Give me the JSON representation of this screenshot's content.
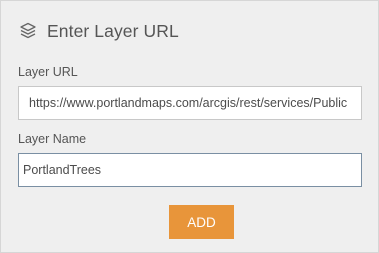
{
  "dialog": {
    "title": "Enter Layer URL",
    "header_icon": "layers-icon"
  },
  "fields": {
    "url": {
      "label": "Layer URL",
      "value": "https://www.portlandmaps.com/arcgis/rest/services/Public"
    },
    "name": {
      "label": "Layer Name",
      "value": "PortlandTrees"
    }
  },
  "actions": {
    "add_label": "ADD"
  },
  "colors": {
    "accent": "#e8953a",
    "panel_background": "#efefef",
    "text": "#4c4c4c"
  }
}
